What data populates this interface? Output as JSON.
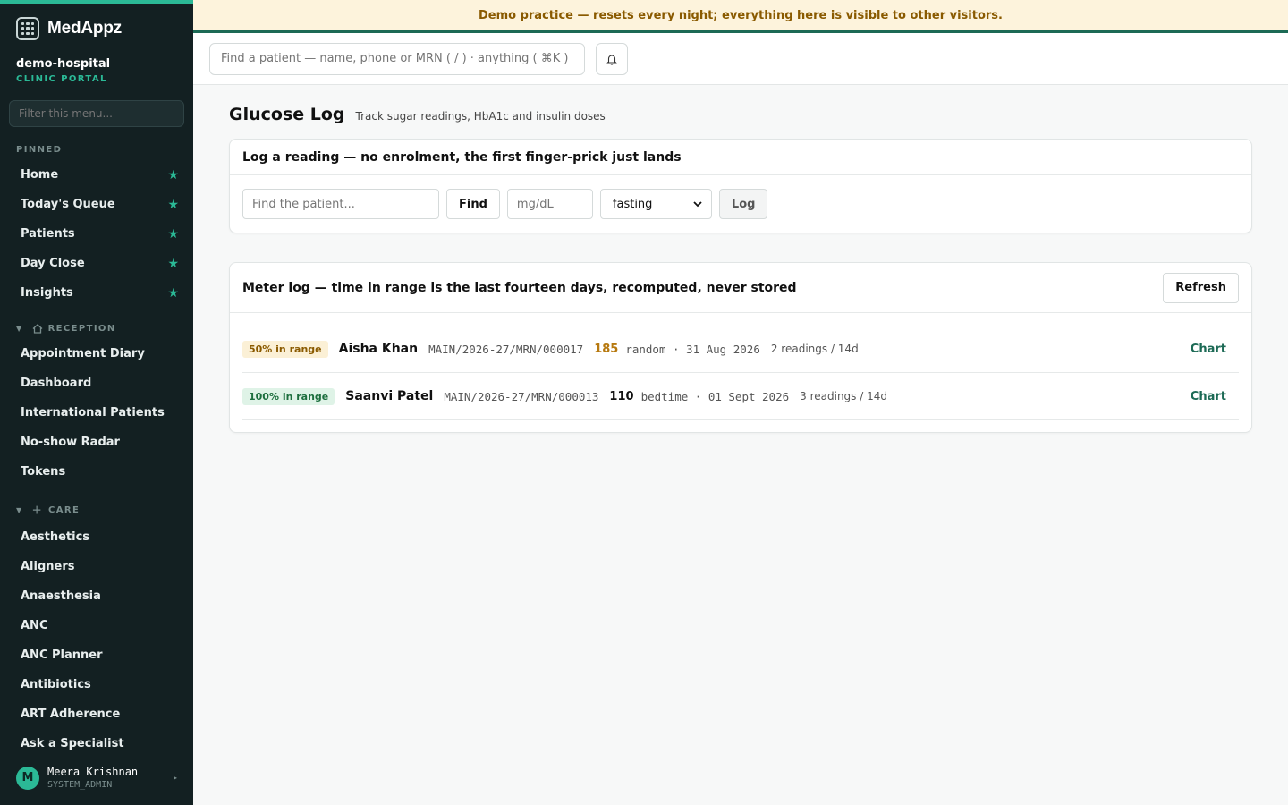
{
  "sidebar": {
    "brand": "MedAppz",
    "org_name": "demo-hospital",
    "org_sub": "CLINIC PORTAL",
    "filter_placeholder": "Filter this menu...",
    "pinned_label": "PINNED",
    "pinned": [
      {
        "label": "Home"
      },
      {
        "label": "Today's Queue"
      },
      {
        "label": "Patients"
      },
      {
        "label": "Day Close"
      },
      {
        "label": "Insights"
      }
    ],
    "groups": [
      {
        "label": "RECEPTION",
        "icon": "home-icon",
        "items": [
          {
            "label": "Appointment Diary"
          },
          {
            "label": "Dashboard"
          },
          {
            "label": "International Patients"
          },
          {
            "label": "No-show Radar"
          },
          {
            "label": "Tokens"
          }
        ]
      },
      {
        "label": "CARE",
        "icon": "plus-icon",
        "items": [
          {
            "label": "Aesthetics"
          },
          {
            "label": "Aligners"
          },
          {
            "label": "Anaesthesia"
          },
          {
            "label": "ANC"
          },
          {
            "label": "ANC Planner"
          },
          {
            "label": "Antibiotics"
          },
          {
            "label": "ART Adherence"
          },
          {
            "label": "Ask a Specialist"
          }
        ]
      }
    ],
    "user": {
      "initial": "M",
      "name": "Meera Krishnan",
      "role": "SYSTEM_ADMIN"
    }
  },
  "banner": "Demo practice — resets every night; everything here is visible to other visitors.",
  "topbar": {
    "search_placeholder": "Find a patient — name, phone or MRN ( / ) · anything ( ⌘K )"
  },
  "page": {
    "title": "Glucose Log",
    "subtitle": "Track sugar readings, HbA1c and insulin doses"
  },
  "log_card": {
    "title": "Log a reading — no enrolment, the first finger-prick just lands",
    "patient_placeholder": "Find the patient...",
    "find_label": "Find",
    "value_placeholder": "mg/dL",
    "context_selected": "fasting",
    "log_label": "Log"
  },
  "meter_card": {
    "title": "Meter log — time in range is the last fourteen days, recomputed, never stored",
    "refresh_label": "Refresh",
    "rows": [
      {
        "badge": "50% in range",
        "name": "Aisha Khan",
        "mrn": "MAIN/2026-27/MRN/000017",
        "value": "185",
        "context": "random · 31 Aug 2026",
        "count": "2 readings / 14d",
        "action": "Chart"
      },
      {
        "badge": "100% in range",
        "name": "Saanvi Patel",
        "mrn": "MAIN/2026-27/MRN/000013",
        "value": "110",
        "context": "bedtime · 01 Sept 2026",
        "count": "3 readings / 14d",
        "action": "Chart"
      }
    ]
  },
  "colors": {
    "accent": "#2bb996",
    "sidebar_bg": "#132022",
    "warn": "#b7790f",
    "ok": "#1d6e3e"
  }
}
